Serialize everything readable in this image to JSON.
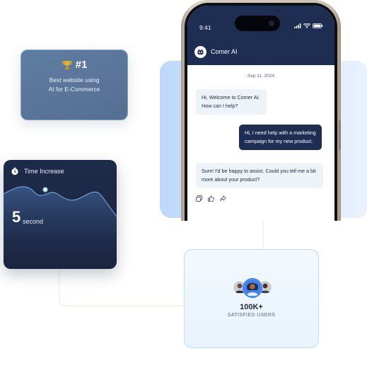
{
  "award": {
    "rank": "#1",
    "line1": "Best website using",
    "line2": "AI for E-Commerce",
    "icon": "trophy-icon"
  },
  "time_card": {
    "label": "Time Increase",
    "value": "5",
    "unit": "second",
    "icon": "clock-icon"
  },
  "phone": {
    "status_time": "9:41",
    "bot_name": "Comer AI",
    "date": "Sep 11, 2024",
    "messages": [
      {
        "from": "bot",
        "line1": "Hi, Welcome to Comer AI.",
        "line2": "How can I help?"
      },
      {
        "from": "user",
        "line1": "Hi, I need help with a marketing",
        "line2": "campaign for my new product."
      },
      {
        "from": "bot",
        "line1": "Sure! I'd be happy to assist. Could you tell me a bit",
        "line2": "more about your product?"
      }
    ],
    "actions": [
      "copy-icon",
      "thumbs-up-icon",
      "share-icon"
    ]
  },
  "users_card": {
    "count": "100K+",
    "label": "SATISFIED USERS"
  },
  "colors": {
    "navy": "#1e2e52",
    "accent_blue": "#3b82f6",
    "light_blue": "#bcd8fb"
  }
}
